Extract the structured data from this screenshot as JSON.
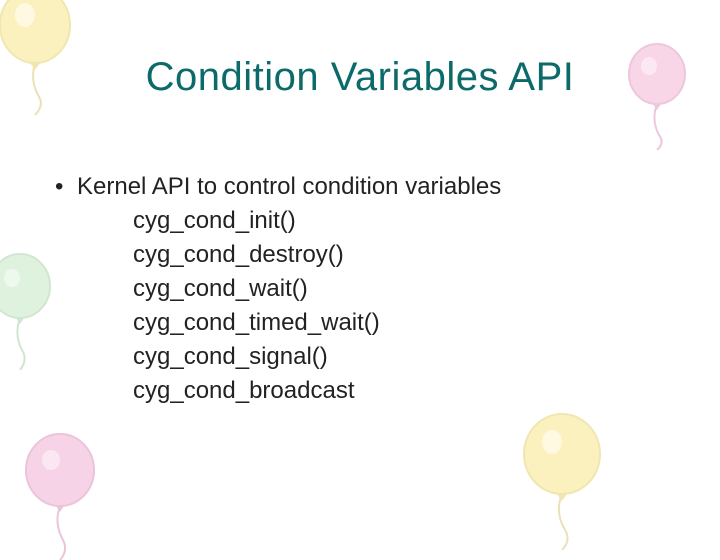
{
  "title": "Condition Variables API",
  "bullet_mark": "•",
  "bullet_text": "Kernel API to control condition variables",
  "api_items": [
    "cyg_cond_init()",
    "cyg_cond_destroy()",
    "cyg_cond_wait()",
    "cyg_cond_timed_wait()",
    "cyg_cond_signal()",
    "cyg_cond_broadcast"
  ]
}
